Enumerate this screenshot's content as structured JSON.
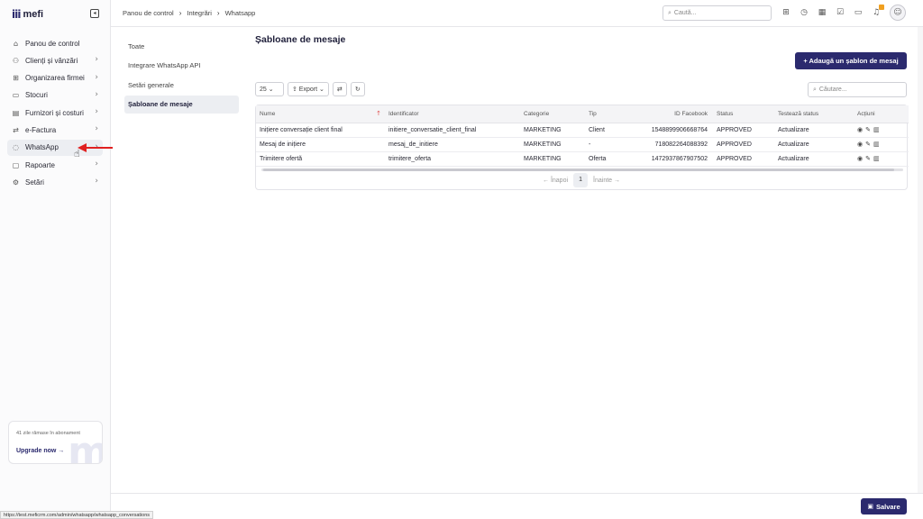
{
  "app": {
    "logo": "mefi"
  },
  "sidebar": {
    "items": [
      {
        "label": "Panou de control",
        "icon": "home-icon",
        "glyph": "⌂",
        "chevron": false
      },
      {
        "label": "Clienți și vânzări",
        "icon": "users-icon",
        "glyph": "⚇",
        "chevron": true
      },
      {
        "label": "Organizarea firmei",
        "icon": "org-icon",
        "glyph": "⊞",
        "chevron": true
      },
      {
        "label": "Stocuri",
        "icon": "box-icon",
        "glyph": "▭",
        "chevron": true
      },
      {
        "label": "Furnizori și costuri",
        "icon": "supplier-icon",
        "glyph": "▤",
        "chevron": true
      },
      {
        "label": "e-Factura",
        "icon": "invoice-icon",
        "glyph": "⇄",
        "chevron": true
      },
      {
        "label": "WhatsApp",
        "icon": "whatsapp-icon",
        "glyph": "◌",
        "chevron": true,
        "active": true
      },
      {
        "label": "Rapoarte",
        "icon": "report-icon",
        "glyph": "▢",
        "chevron": true
      },
      {
        "label": "Setări",
        "icon": "gear-icon",
        "glyph": "⚙",
        "chevron": true
      }
    ],
    "promo_text": "41 zile rămase în abonament",
    "promo_link": "Upgrade now →"
  },
  "header": {
    "breadcrumb": [
      "Panou de control",
      "Integrări",
      "Whatsapp"
    ],
    "search_placeholder": "Caută..."
  },
  "subnav": {
    "items": [
      {
        "label": "Toate"
      },
      {
        "label": "Integrare WhatsApp API"
      },
      {
        "label": "Setări generale"
      },
      {
        "label": "Șabloane de mesaje",
        "active": true
      }
    ]
  },
  "main": {
    "title": "Șabloane de mesaje",
    "add_button": "+ Adaugă un șablon de mesaj",
    "page_size": "25 ⌄",
    "export_label": "⇪ Export ⌄",
    "table_search_placeholder": "Căutare...",
    "columns": [
      "Nume",
      "Identificator",
      "Categorie",
      "Tip",
      "ID Facebook",
      "Status",
      "Testează status",
      "Acțiuni"
    ],
    "rows": [
      [
        "Inițiere conversație client final",
        "initiere_conversatie_client_final",
        "MARKETING",
        "Client",
        "1548899906668764",
        "APPROVED",
        "Actualizare"
      ],
      [
        "Mesaj de inițiere",
        "mesaj_de_initiere",
        "MARKETING",
        "-",
        "718082264088392",
        "APPROVED",
        "Actualizare"
      ],
      [
        "Trimitere ofertă",
        "trimitere_oferta",
        "MARKETING",
        "Oferta",
        "1472937867907502",
        "APPROVED",
        "Actualizare"
      ]
    ],
    "pagination": {
      "prev": "← Înapoi",
      "page": "1",
      "next": "Înainte →"
    }
  },
  "footer": {
    "save_label": "Salvare"
  },
  "status_url": "https://test.meficrm.com/admin/whatsapp/whatsapp_conversations",
  "colors": {
    "brand": "#2b2a6e",
    "annotation_arrow": "#e02020"
  }
}
